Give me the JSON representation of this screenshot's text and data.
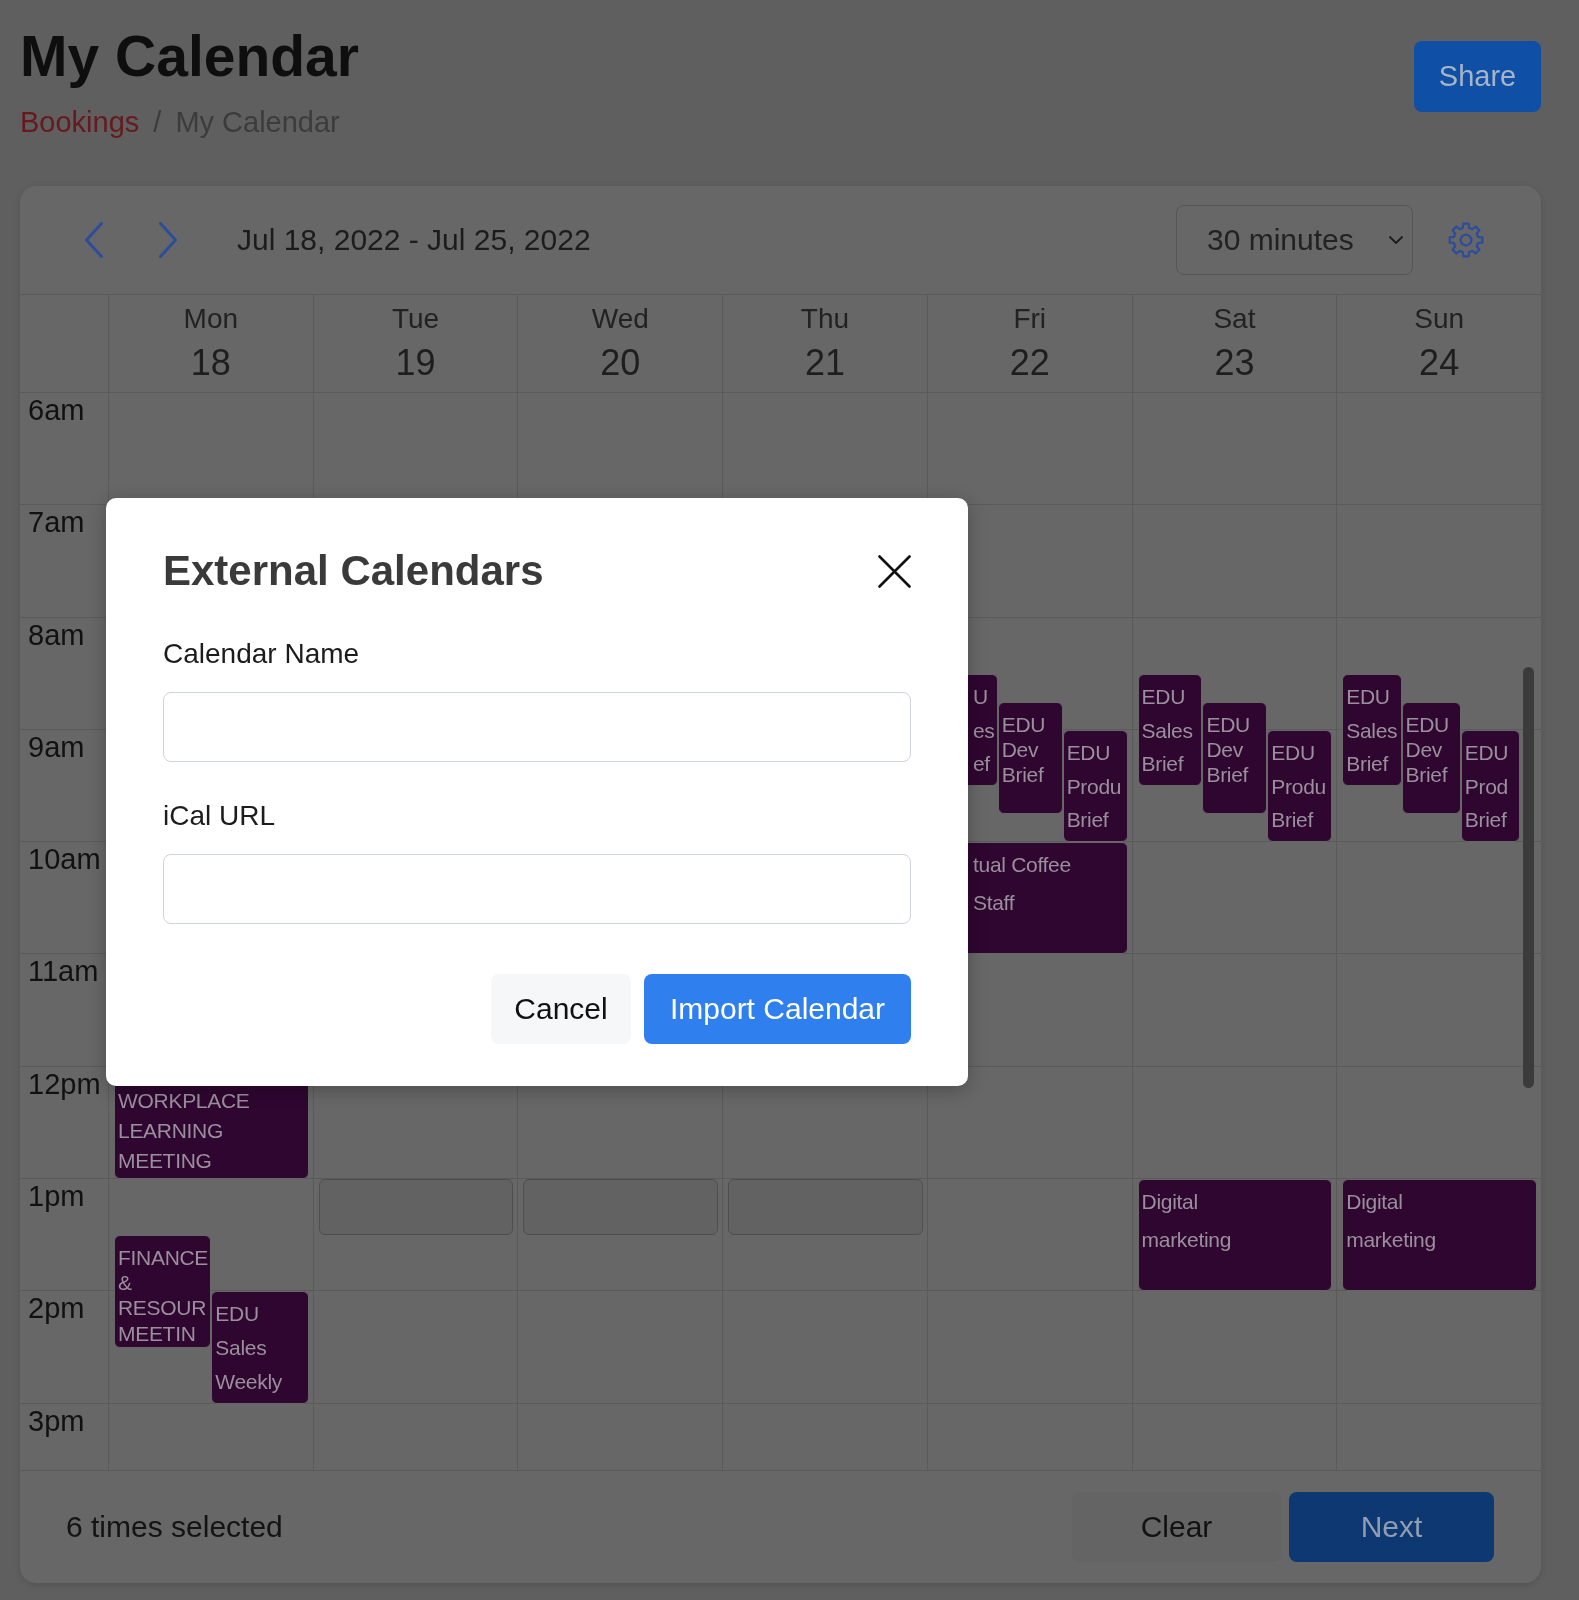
{
  "page": {
    "title": "My Calendar",
    "share_button": "Share"
  },
  "breadcrumb": {
    "separator": "/",
    "items": [
      {
        "label": "Bookings",
        "kind": "link"
      },
      {
        "label": "My Calendar",
        "kind": "current"
      }
    ]
  },
  "toolbar": {
    "date_range": "Jul 18, 2022 - Jul 25, 2022",
    "interval": "30 minutes"
  },
  "calendar": {
    "hours": [
      "6am",
      "7am",
      "8am",
      "9am",
      "10am",
      "11am",
      "12pm",
      "1pm",
      "2pm",
      "3pm"
    ],
    "days": [
      {
        "name": "Mon",
        "date": "18",
        "items": [
          {
            "kind": "event",
            "title_lines": [
              "WORKPLACE",
              "LEARNING",
              "MEETING"
            ]
          },
          {
            "kind": "event",
            "title_lines": [
              "FINANCE &",
              "RESOUR",
              "MEETIN"
            ]
          },
          {
            "kind": "event",
            "title_lines": [
              "EDU",
              "Sales",
              "Weekly"
            ]
          }
        ]
      },
      {
        "name": "Tue",
        "date": "19",
        "items": [
          {
            "kind": "selection"
          }
        ]
      },
      {
        "name": "Wed",
        "date": "20",
        "items": [
          {
            "kind": "selection"
          }
        ]
      },
      {
        "name": "Thu",
        "date": "21",
        "items": [
          {
            "kind": "selection"
          }
        ]
      },
      {
        "name": "Fri",
        "date": "22",
        "items": [
          {
            "kind": "event",
            "title_lines": [
              "U",
              "es",
              "ef"
            ]
          },
          {
            "kind": "event",
            "title_lines": [
              "EDU Dev",
              "Brief"
            ]
          },
          {
            "kind": "event",
            "title_lines": [
              "EDU",
              "Produ",
              "Brief"
            ]
          },
          {
            "kind": "event",
            "title_lines": [
              "tual Coffee",
              "Staff"
            ]
          }
        ]
      },
      {
        "name": "Sat",
        "date": "23",
        "items": [
          {
            "kind": "event",
            "title_lines": [
              "EDU",
              "Sales",
              "Brief"
            ]
          },
          {
            "kind": "event",
            "title_lines": [
              "EDU Dev",
              "Brief"
            ]
          },
          {
            "kind": "event",
            "title_lines": [
              "EDU",
              "Produ",
              "Brief"
            ]
          },
          {
            "kind": "event",
            "title_lines": [
              "Digital",
              "marketing"
            ]
          }
        ]
      },
      {
        "name": "Sun",
        "date": "24",
        "items": [
          {
            "kind": "event",
            "title_lines": [
              "EDU",
              "Sales",
              "Brief"
            ]
          },
          {
            "kind": "event",
            "title_lines": [
              "EDU Dev",
              "Brief"
            ]
          },
          {
            "kind": "event",
            "title_lines": [
              "EDU",
              "Prod",
              "Brief"
            ]
          },
          {
            "kind": "event",
            "title_lines": [
              "Digital",
              "marketing"
            ]
          }
        ]
      }
    ]
  },
  "footer": {
    "selection_count": "6 times selected",
    "buttons": [
      {
        "label": "Clear",
        "kind": "secondary"
      },
      {
        "label": "Next",
        "kind": "primary"
      }
    ]
  },
  "dialog": {
    "title": "External Calendars",
    "fields": [
      {
        "label": "Calendar Name"
      },
      {
        "label": "iCal URL"
      }
    ],
    "buttons": [
      {
        "label": "Cancel",
        "kind": "secondary"
      },
      {
        "label": "Import Calendar",
        "kind": "primary"
      }
    ]
  }
}
